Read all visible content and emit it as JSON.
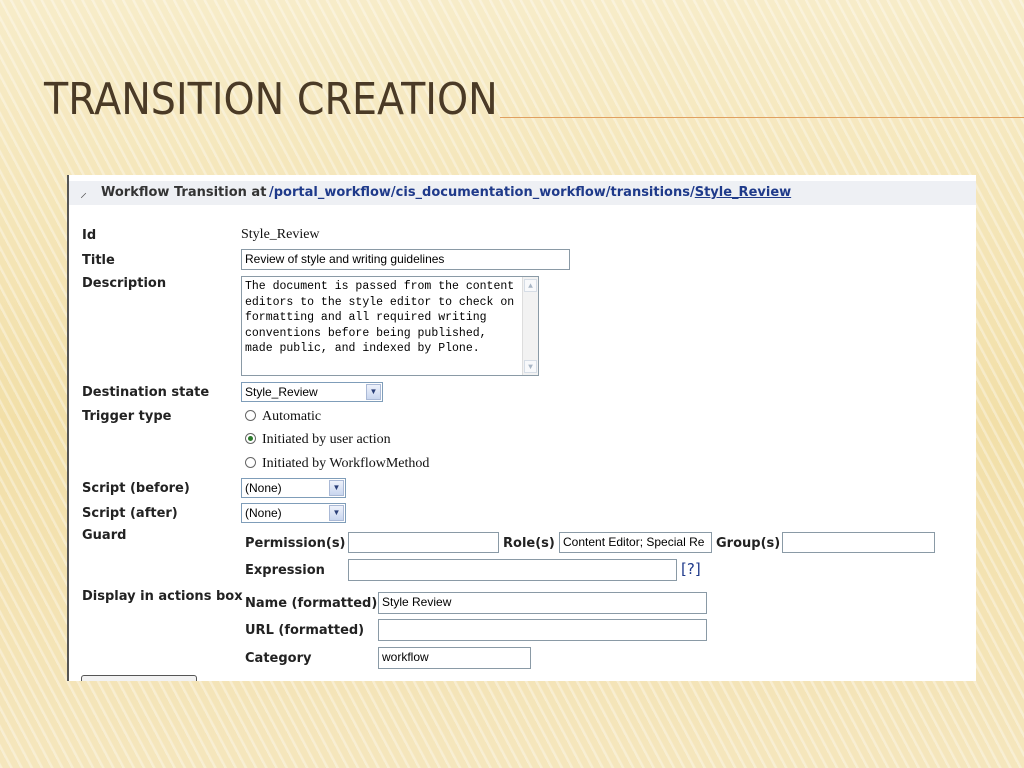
{
  "slide": {
    "title": "TRANSITION CREATION"
  },
  "header": {
    "label": "Workflow Transition at",
    "path_prefix": "/portal_workflow/cis_documentation_workflow/transitions/",
    "path_current": "Style_Review"
  },
  "form": {
    "id": {
      "label": "Id",
      "value": "Style_Review"
    },
    "title": {
      "label": "Title",
      "value": "Review of style and writing guidelines"
    },
    "description": {
      "label": "Description",
      "value": "The document is passed from the content editors to the style editor to check on formatting and all required writing conventions before being published, made public, and indexed by Plone."
    },
    "destination_state": {
      "label": "Destination state",
      "value": "Style_Review"
    },
    "trigger_type": {
      "label": "Trigger type",
      "options": [
        {
          "label": "Automatic",
          "selected": false
        },
        {
          "label": "Initiated by user action",
          "selected": true
        },
        {
          "label": "Initiated by WorkflowMethod",
          "selected": false
        }
      ]
    },
    "script_before": {
      "label": "Script (before)",
      "value": "(None)"
    },
    "script_after": {
      "label": "Script (after)",
      "value": "(None)"
    },
    "guard": {
      "label": "Guard",
      "permissions_label": "Permission(s)",
      "permissions_value": "",
      "roles_label": "Role(s)",
      "roles_value": "Content Editor; Special Re",
      "groups_label": "Group(s)",
      "groups_value": "",
      "expression_label": "Expression",
      "expression_value": "",
      "help_label": "[?]"
    },
    "actions_box": {
      "label": "Display in actions box",
      "name_label": "Name (formatted)",
      "name_value": "Style Review",
      "url_label": "URL (formatted)",
      "url_value": "",
      "category_label": "Category",
      "category_value": "workflow"
    }
  },
  "icons": {
    "workflow": "workflow-transition-icon",
    "select_arrow": "chevron-down-icon",
    "scroll_up": "scroll-up-icon",
    "scroll_down": "scroll-down-icon"
  },
  "colors": {
    "title_text": "#4a3a26",
    "link": "#1f3a8a",
    "title_rule": "#e0a060",
    "radio_selected": "#2c7a2c"
  }
}
